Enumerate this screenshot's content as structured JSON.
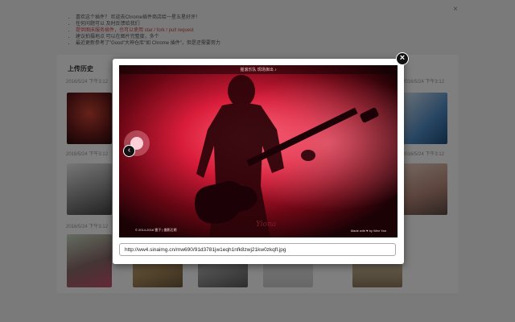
{
  "background": {
    "tips": [
      {
        "text": "喜欢这个插件？ 欢迎去Chrome插件商店给一星五星好评！",
        "highlight": false
      },
      {
        "text": "任何问题可以 及时反馈给我们",
        "highlight": false
      },
      {
        "text": "提供图床服务插件，也可以使用 star / fork / pull request",
        "highlight": true
      },
      {
        "text": "建议拍摄地点 可以在图片完整度，多个",
        "highlight": false
      },
      {
        "text": "最近更新参考了\"Good\"大神仓库\"如 Chrome 插件\"，但是还需要努力",
        "highlight": false
      }
    ],
    "close_glyph": "×",
    "history": {
      "title": "上传历史",
      "dates": [
        "2016/5/24 下午3:12",
        "2016/5/24 下午3:12",
        "2016/5/24 下午3:12",
        "2016/5/24 下午3:12",
        "2016/5/24 下午3:12"
      ]
    }
  },
  "lightbox": {
    "caption": "摇滚乐队   现场演出 ♪",
    "credit_left": "© 2014-2016  雷子  |  摄影后期",
    "credit_right": "Made with ♥ by Wen Yan",
    "signature": "Yiona",
    "url": "http://ww4.sinaimg.cn/mw690/91d3781jw1eqh1nfk8zwj21kw0zkqfl.jpg",
    "prev_glyph": "‹",
    "close_glyph": "×"
  }
}
